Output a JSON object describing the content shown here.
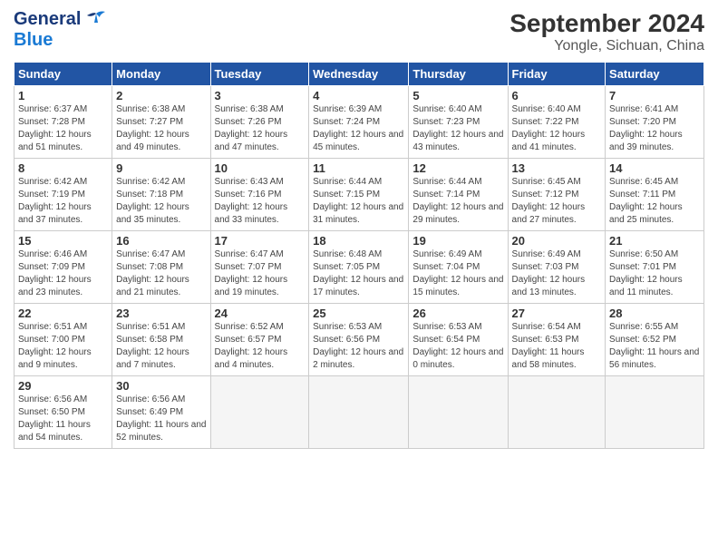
{
  "header": {
    "logo": {
      "general": "General",
      "blue": "Blue"
    },
    "title": "September 2024",
    "subtitle": "Yongle, Sichuan, China"
  },
  "calendar": {
    "days_of_week": [
      "Sunday",
      "Monday",
      "Tuesday",
      "Wednesday",
      "Thursday",
      "Friday",
      "Saturday"
    ],
    "weeks": [
      [
        {
          "day": "",
          "empty": true
        },
        {
          "day": "",
          "empty": true
        },
        {
          "day": "",
          "empty": true
        },
        {
          "day": "",
          "empty": true
        },
        {
          "day": "",
          "empty": true
        },
        {
          "day": "",
          "empty": true
        },
        {
          "day": "",
          "empty": true
        }
      ]
    ],
    "cells": [
      {
        "date": "1",
        "sunrise": "6:37 AM",
        "sunset": "7:28 PM",
        "daylight": "12 hours and 51 minutes."
      },
      {
        "date": "2",
        "sunrise": "6:38 AM",
        "sunset": "7:27 PM",
        "daylight": "12 hours and 49 minutes."
      },
      {
        "date": "3",
        "sunrise": "6:38 AM",
        "sunset": "7:26 PM",
        "daylight": "12 hours and 47 minutes."
      },
      {
        "date": "4",
        "sunrise": "6:39 AM",
        "sunset": "7:24 PM",
        "daylight": "12 hours and 45 minutes."
      },
      {
        "date": "5",
        "sunrise": "6:40 AM",
        "sunset": "7:23 PM",
        "daylight": "12 hours and 43 minutes."
      },
      {
        "date": "6",
        "sunrise": "6:40 AM",
        "sunset": "7:22 PM",
        "daylight": "12 hours and 41 minutes."
      },
      {
        "date": "7",
        "sunrise": "6:41 AM",
        "sunset": "7:20 PM",
        "daylight": "12 hours and 39 minutes."
      },
      {
        "date": "8",
        "sunrise": "6:42 AM",
        "sunset": "7:19 PM",
        "daylight": "12 hours and 37 minutes."
      },
      {
        "date": "9",
        "sunrise": "6:42 AM",
        "sunset": "7:18 PM",
        "daylight": "12 hours and 35 minutes."
      },
      {
        "date": "10",
        "sunrise": "6:43 AM",
        "sunset": "7:16 PM",
        "daylight": "12 hours and 33 minutes."
      },
      {
        "date": "11",
        "sunrise": "6:44 AM",
        "sunset": "7:15 PM",
        "daylight": "12 hours and 31 minutes."
      },
      {
        "date": "12",
        "sunrise": "6:44 AM",
        "sunset": "7:14 PM",
        "daylight": "12 hours and 29 minutes."
      },
      {
        "date": "13",
        "sunrise": "6:45 AM",
        "sunset": "7:12 PM",
        "daylight": "12 hours and 27 minutes."
      },
      {
        "date": "14",
        "sunrise": "6:45 AM",
        "sunset": "7:11 PM",
        "daylight": "12 hours and 25 minutes."
      },
      {
        "date": "15",
        "sunrise": "6:46 AM",
        "sunset": "7:09 PM",
        "daylight": "12 hours and 23 minutes."
      },
      {
        "date": "16",
        "sunrise": "6:47 AM",
        "sunset": "7:08 PM",
        "daylight": "12 hours and 21 minutes."
      },
      {
        "date": "17",
        "sunrise": "6:47 AM",
        "sunset": "7:07 PM",
        "daylight": "12 hours and 19 minutes."
      },
      {
        "date": "18",
        "sunrise": "6:48 AM",
        "sunset": "7:05 PM",
        "daylight": "12 hours and 17 minutes."
      },
      {
        "date": "19",
        "sunrise": "6:49 AM",
        "sunset": "7:04 PM",
        "daylight": "12 hours and 15 minutes."
      },
      {
        "date": "20",
        "sunrise": "6:49 AM",
        "sunset": "7:03 PM",
        "daylight": "12 hours and 13 minutes."
      },
      {
        "date": "21",
        "sunrise": "6:50 AM",
        "sunset": "7:01 PM",
        "daylight": "12 hours and 11 minutes."
      },
      {
        "date": "22",
        "sunrise": "6:51 AM",
        "sunset": "7:00 PM",
        "daylight": "12 hours and 9 minutes."
      },
      {
        "date": "23",
        "sunrise": "6:51 AM",
        "sunset": "6:58 PM",
        "daylight": "12 hours and 7 minutes."
      },
      {
        "date": "24",
        "sunrise": "6:52 AM",
        "sunset": "6:57 PM",
        "daylight": "12 hours and 4 minutes."
      },
      {
        "date": "25",
        "sunrise": "6:53 AM",
        "sunset": "6:56 PM",
        "daylight": "12 hours and 2 minutes."
      },
      {
        "date": "26",
        "sunrise": "6:53 AM",
        "sunset": "6:54 PM",
        "daylight": "12 hours and 0 minutes."
      },
      {
        "date": "27",
        "sunrise": "6:54 AM",
        "sunset": "6:53 PM",
        "daylight": "11 hours and 58 minutes."
      },
      {
        "date": "28",
        "sunrise": "6:55 AM",
        "sunset": "6:52 PM",
        "daylight": "11 hours and 56 minutes."
      },
      {
        "date": "29",
        "sunrise": "6:56 AM",
        "sunset": "6:50 PM",
        "daylight": "11 hours and 54 minutes."
      },
      {
        "date": "30",
        "sunrise": "6:56 AM",
        "sunset": "6:49 PM",
        "daylight": "11 hours and 52 minutes."
      }
    ]
  }
}
